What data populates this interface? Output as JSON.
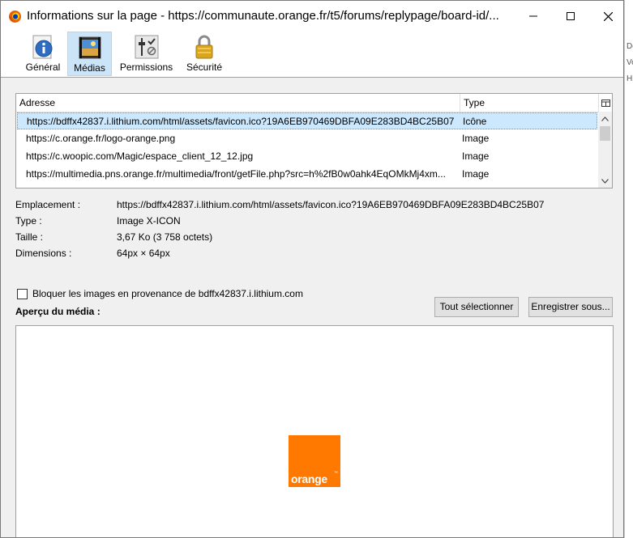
{
  "window": {
    "title": "Informations sur la page - https://communaute.orange.fr/t5/forums/replypage/board-id/..."
  },
  "background": {
    "right_fragments": [
      "De",
      "Vo",
      "Hi"
    ]
  },
  "toolbar": {
    "items": [
      {
        "label": "Général",
        "icon": "info-icon",
        "selected": false
      },
      {
        "label": "Médias",
        "icon": "media-icon",
        "selected": true
      },
      {
        "label": "Permissions",
        "icon": "permissions-icon",
        "selected": false
      },
      {
        "label": "Sécurité",
        "icon": "padlock-icon",
        "selected": false
      }
    ]
  },
  "media_list": {
    "columns": {
      "address": "Adresse",
      "type": "Type"
    },
    "rows": [
      {
        "address": "https://bdffx42837.i.lithium.com/html/assets/favicon.ico?19A6EB970469DBFA09E283BD4BC25B07",
        "type": "Icône",
        "selected": true
      },
      {
        "address": "https://c.orange.fr/logo-orange.png",
        "type": "Image",
        "selected": false
      },
      {
        "address": "https://c.woopic.com/Magic/espace_client_12_12.jpg",
        "type": "Image",
        "selected": false
      },
      {
        "address": "https://multimedia.pns.orange.fr/multimedia/front/getFile.php?src=h%2fB0w0ahk4EqOMkMj4xm...",
        "type": "Image",
        "selected": false
      }
    ]
  },
  "properties": {
    "location_label": "Emplacement :",
    "location_value": "https://bdffx42837.i.lithium.com/html/assets/favicon.ico?19A6EB970469DBFA09E283BD4BC25B07",
    "type_label": "Type :",
    "type_value": "Image X-ICON",
    "size_label": "Taille :",
    "size_value": "3,67 Ko (3 758 octets)",
    "dimensions_label": "Dimensions :",
    "dimensions_value": "64px × 64px"
  },
  "block_images": {
    "label": "Bloquer les images en provenance de bdffx42837.i.lithium.com",
    "checked": false
  },
  "preview": {
    "title": "Aperçu du média :",
    "logo_text": "orange",
    "logo_tm": "™",
    "logo_color": "#ff7900"
  },
  "buttons": {
    "select_all": "Tout sélectionner",
    "save_as": "Enregistrer sous..."
  }
}
